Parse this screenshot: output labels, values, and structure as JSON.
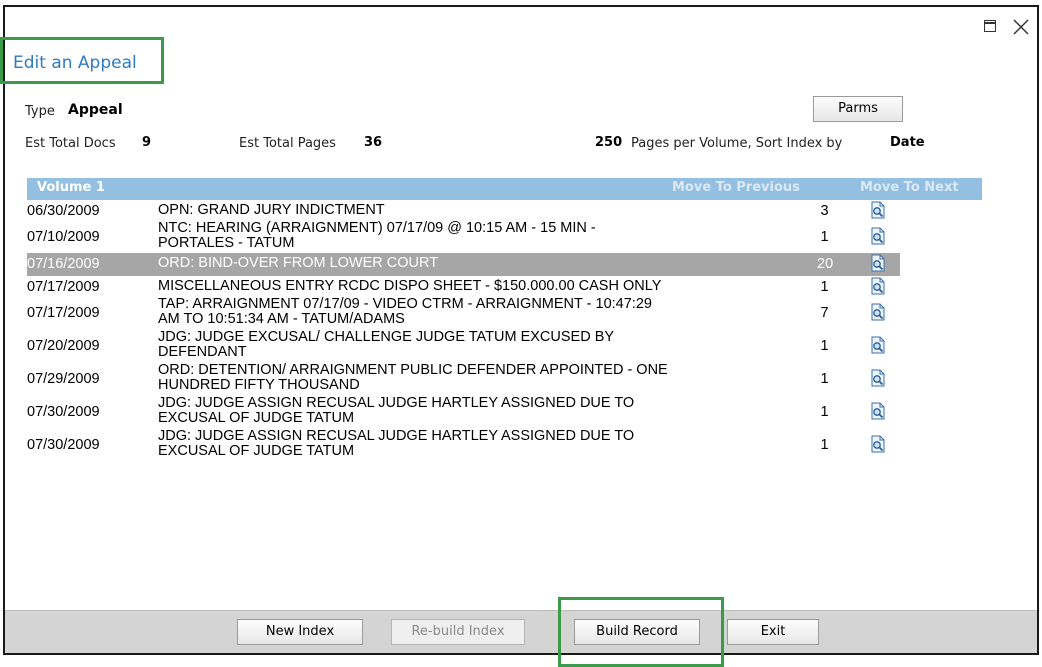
{
  "window": {
    "title_section": "Edit an Appeal"
  },
  "info": {
    "type_label": "Type",
    "type_value": "Appeal",
    "parms_button": "Parms",
    "est_docs_label": "Est Total Docs",
    "est_docs_value": "9",
    "est_pages_label": "Est Total Pages",
    "est_pages_value": "36",
    "pages_per_volume_value": "250",
    "pages_per_volume_label": "Pages per Volume, Sort Index by",
    "sort_value": "Date"
  },
  "volume": {
    "header": "Volume 1",
    "move_prev": "Move To Previous",
    "move_next": "Move To Next",
    "rows": [
      {
        "date": "06/30/2009",
        "desc": [
          "OPN: GRAND JURY INDICTMENT"
        ],
        "pages": "3",
        "selected": false
      },
      {
        "date": "07/10/2009",
        "desc": [
          "NTC: HEARING (ARRAIGNMENT) 07/17/09 @ 10:15 AM - 15 MIN -",
          "PORTALES - TATUM"
        ],
        "pages": "1",
        "selected": false
      },
      {
        "date": "07/16/2009",
        "desc": [
          "ORD: BIND-OVER FROM LOWER COURT"
        ],
        "pages": "20",
        "selected": true
      },
      {
        "date": "07/17/2009",
        "desc": [
          "MISCELLANEOUS ENTRY RCDC DISPO SHEET - $150.000.00 CASH ONLY"
        ],
        "pages": "1",
        "selected": false
      },
      {
        "date": "07/17/2009",
        "desc": [
          "TAP: ARRAIGNMENT 07/17/09 - VIDEO CTRM - ARRAIGNMENT - 10:47:29",
          "AM TO 10:51:34 AM - TATUM/ADAMS"
        ],
        "pages": "7",
        "selected": false
      },
      {
        "date": "07/20/2009",
        "desc": [
          "JDG: JUDGE EXCUSAL/ CHALLENGE JUDGE TATUM EXCUSED BY",
          "DEFENDANT"
        ],
        "pages": "1",
        "selected": false
      },
      {
        "date": "07/29/2009",
        "desc": [
          "ORD: DETENTION/ ARRAIGNMENT PUBLIC DEFENDER APPOINTED - ONE",
          "HUNDRED FIFTY THOUSAND"
        ],
        "pages": "1",
        "selected": false
      },
      {
        "date": "07/30/2009",
        "desc": [
          "JDG: JUDGE ASSIGN RECUSAL JUDGE HARTLEY ASSIGNED DUE TO",
          "EXCUSAL OF JUDGE TATUM"
        ],
        "pages": "1",
        "selected": false
      },
      {
        "date": "07/30/2009",
        "desc": [
          "JDG: JUDGE ASSIGN RECUSAL JUDGE HARTLEY ASSIGNED DUE TO",
          "EXCUSAL OF JUDGE TATUM"
        ],
        "pages": "1",
        "selected": false
      }
    ]
  },
  "buttons": {
    "new_index": "New Index",
    "rebuild_index": "Re-build Index",
    "build_record": "Build Record",
    "exit": "Exit"
  },
  "colors": {
    "accent": "#2f7bc0",
    "highlight": "#3a9b48",
    "volume_header": "#93bfe0",
    "selected_row": "#a6a6a6"
  }
}
